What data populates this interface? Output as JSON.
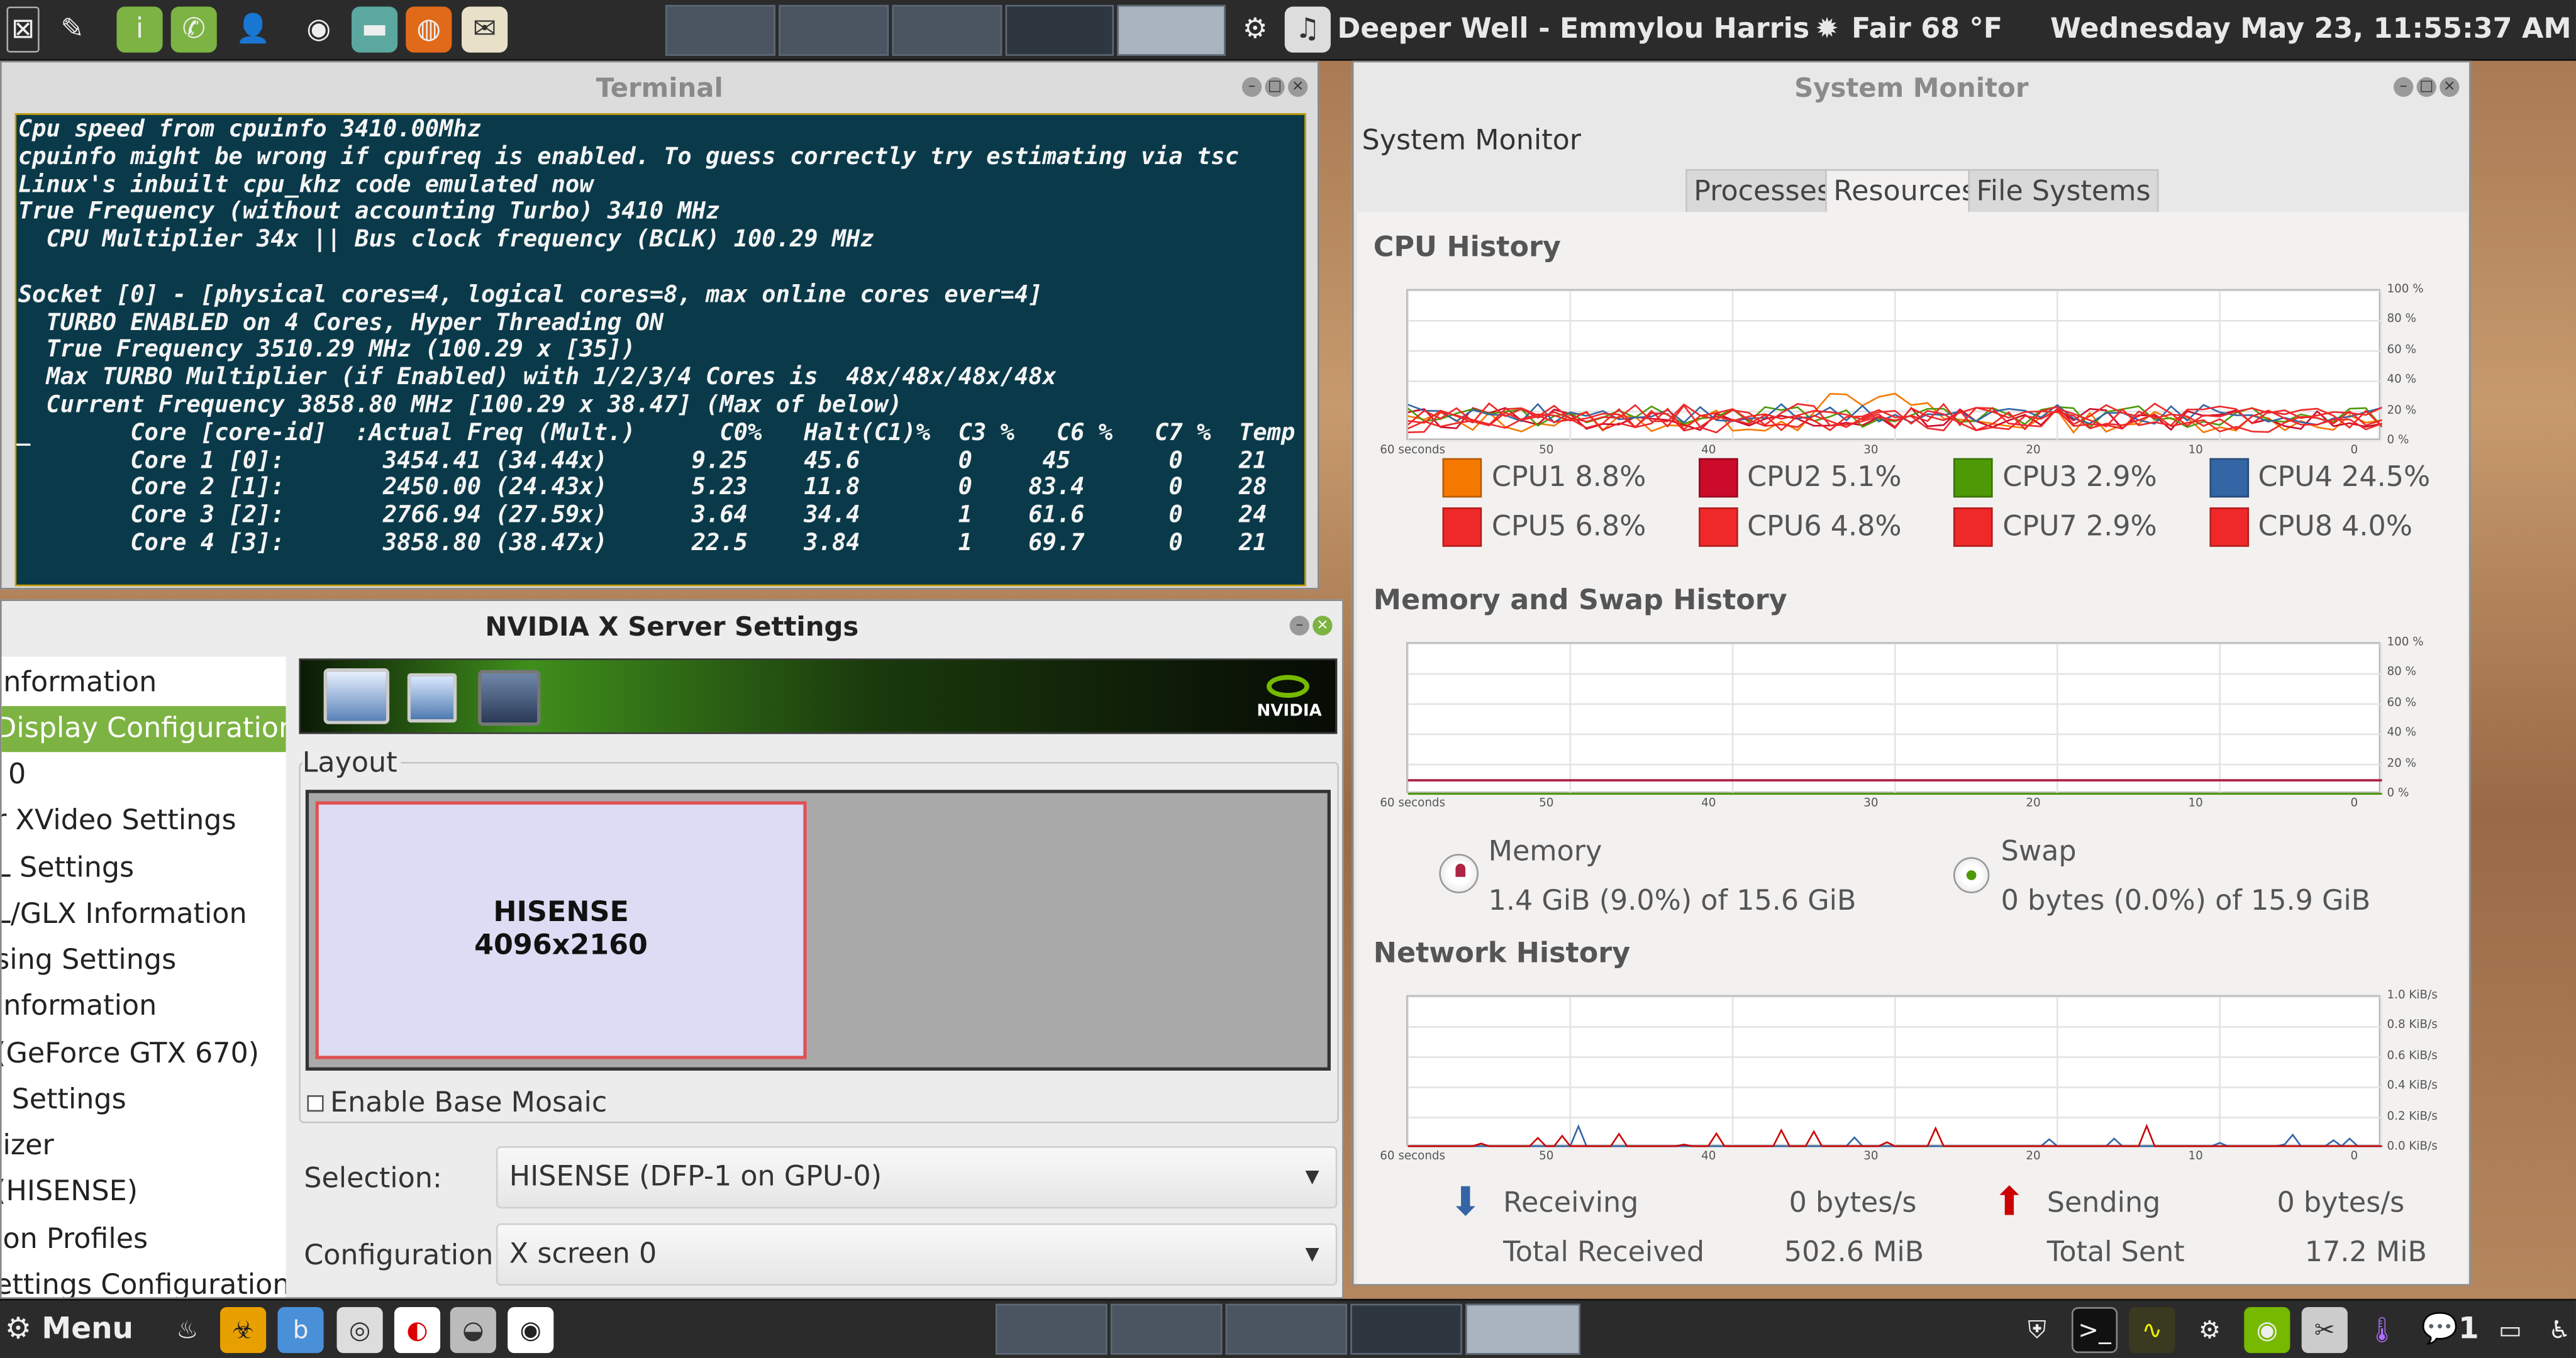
{
  "topbar": {
    "workspaces_count": 5,
    "now_playing": "Deeper Well - Emmylou Harris",
    "weather": "Fair 68 °F",
    "datetime": "Wednesday May 23, 11:55:37 AM"
  },
  "terminal": {
    "title": "Terminal",
    "lines": [
      "Cpu speed from cpuinfo 3410.00Mhz",
      "cpuinfo might be wrong if cpufreq is enabled. To guess correctly try estimating via tsc",
      "Linux's inbuilt cpu_khz code emulated now",
      "True Frequency (without accounting Turbo) 3410 MHz",
      "  CPU Multiplier 34x || Bus clock frequency (BCLK) 100.29 MHz",
      "",
      "Socket [0] - [physical cores=4, logical cores=8, max online cores ever=4]",
      "  TURBO ENABLED on 4 Cores, Hyper Threading ON",
      "  True Frequency 3510.29 MHz (100.29 x [35])",
      "  Max TURBO Multiplier (if Enabled) with 1/2/3/4 Cores is  48x/48x/48x/48x",
      "  Current Frequency 3858.80 MHz [100.29 x 38.47] (Max of below)",
      "        Core [core-id]  :Actual Freq (Mult.)      C0%   Halt(C1)%  C3 %   C6 %   C7 %  Temp",
      "        Core 1 [0]:       3454.41 (34.44x)      9.25    45.6       0     45       0    21",
      "        Core 2 [1]:       2450.00 (24.43x)      5.23    11.8       0    83.4      0    28",
      "        Core 3 [2]:       2766.94 (27.59x)      3.64    34.4       1    61.6      0    24",
      "        Core 4 [3]:       3858.80 (38.47x)      22.5    3.84       1    69.7      0    21"
    ],
    "cursor": "_"
  },
  "nvidia": {
    "title": "NVIDIA X Server Settings",
    "sidebar": [
      {
        "label": "Information",
        "selected": false
      },
      {
        "label": "Display Configuration",
        "selected": true
      },
      {
        "label": "0",
        "selected": false
      },
      {
        "label": "r XVideo Settings",
        "selected": false
      },
      {
        "label": "L Settings",
        "selected": false
      },
      {
        "label": "L/GLX Information",
        "selected": false
      },
      {
        "label": "sing Settings",
        "selected": false
      },
      {
        "label": "Information",
        "selected": false
      },
      {
        "label": "(GeForce GTX 670)",
        "selected": false
      },
      {
        "label": "l Settings",
        "selected": false
      },
      {
        "label": "lizer",
        "selected": false
      },
      {
        "label": "(HISENSE)",
        "selected": false
      },
      {
        "label": "ion Profiles",
        "selected": false
      },
      {
        "label": "ettings Configuration",
        "selected": false
      }
    ],
    "brand": "NVIDIA",
    "layout_label": "Layout",
    "display_name": "HISENSE",
    "display_resolution": "4096x2160",
    "mosaic_label": "Enable Base Mosaic",
    "mosaic_checked": false,
    "selection_label": "Selection:",
    "selection_value": "HISENSE (DFP-1 on GPU-0)",
    "configuration_label": "Configuration:",
    "configuration_value": "X screen 0"
  },
  "sysmon": {
    "title": "System Monitor",
    "app_label": "System Monitor",
    "tabs": [
      {
        "label": "Processes",
        "active": false
      },
      {
        "label": "Resources",
        "active": true
      },
      {
        "label": "File Systems",
        "active": false
      }
    ],
    "cpu_section": "CPU History",
    "mem_section": "Memory and Swap History",
    "net_section": "Network History",
    "pct_ticks": [
      "100 %",
      "80 %",
      "60 %",
      "40 %",
      "20 %",
      "0 %"
    ],
    "time_ticks": [
      "60 seconds",
      "50",
      "40",
      "30",
      "20",
      "10",
      "0"
    ],
    "net_ticks": [
      "1.0 KiB/s",
      "0.8 KiB/s",
      "0.6 KiB/s",
      "0.4 KiB/s",
      "0.2 KiB/s",
      "0.0 KiB/s"
    ],
    "cpus": [
      {
        "label": "CPU1 8.8%",
        "color": "#f57900"
      },
      {
        "label": "CPU2 5.1%",
        "color": "#cc0a2a"
      },
      {
        "label": "CPU3 2.9%",
        "color": "#4e9a06"
      },
      {
        "label": "CPU4 24.5%",
        "color": "#3465a4"
      },
      {
        "label": "CPU5 6.8%",
        "color": "#ef2929"
      },
      {
        "label": "CPU6 4.8%",
        "color": "#ef2929"
      },
      {
        "label": "CPU7 2.9%",
        "color": "#ef2929"
      },
      {
        "label": "CPU8 4.0%",
        "color": "#ef2929"
      }
    ],
    "memory": {
      "label": "Memory",
      "value": "1.4 GiB (9.0%) of 15.6 GiB",
      "color": "#ad2545",
      "fraction": 0.09
    },
    "swap": {
      "label": "Swap",
      "value": "0 bytes (0.0%) of 15.9 GiB",
      "color": "#4e9a06",
      "fraction": 0.0
    },
    "network": {
      "receiving_label": "Receiving",
      "receiving_value": "0 bytes/s",
      "total_received_label": "Total Received",
      "total_received_value": "502.6 MiB",
      "sending_label": "Sending",
      "sending_value": "0 bytes/s",
      "total_sent_label": "Total Sent",
      "total_sent_value": "17.2 MiB",
      "receiving_color": "#3465a4",
      "sending_color": "#cc0000"
    }
  },
  "bottombar": {
    "menu_label": "Menu",
    "workspaces_count": 5,
    "notification_count": "1"
  }
}
